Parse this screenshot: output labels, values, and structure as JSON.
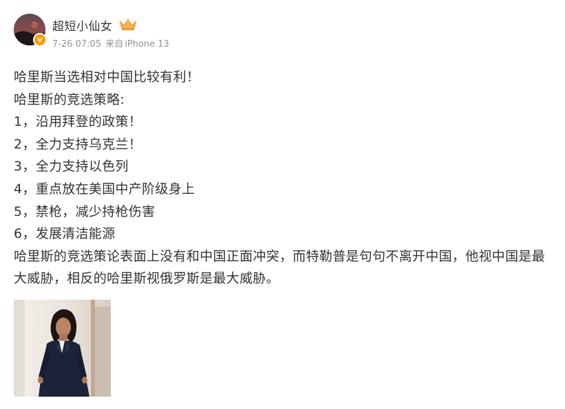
{
  "post": {
    "author": {
      "name": "超短小仙女",
      "avatar_icon": "avatar-icon",
      "verified_icon": "verified-badge-icon",
      "crown_icon": "crown-icon"
    },
    "meta": {
      "time": "7-26 07:05",
      "source_prefix": "来自",
      "source": "iPhone 13"
    },
    "lines": [
      "哈里斯当选相对中国比较有利！",
      "哈里斯的竞选策略:",
      "1，沿用拜登的政策！",
      "2，全力支持乌克兰！",
      "3，全力支持以色列",
      "4，重点放在美国中产阶级身上",
      "5，禁枪，减少持枪伤害",
      "6，发展清洁能源"
    ],
    "paragraph": "哈里斯的竞选策论表面上没有和中国正面冲突，而特勒普是句句不离开中国，他视中国是最大威胁，相反的哈里斯视俄罗斯是最大威胁。",
    "photo": {
      "icon": "photo-thumbnail"
    }
  },
  "colors": {
    "text": "#333333",
    "meta": "#939393",
    "verified": "#ff9a00",
    "crown": "#f5a623"
  }
}
